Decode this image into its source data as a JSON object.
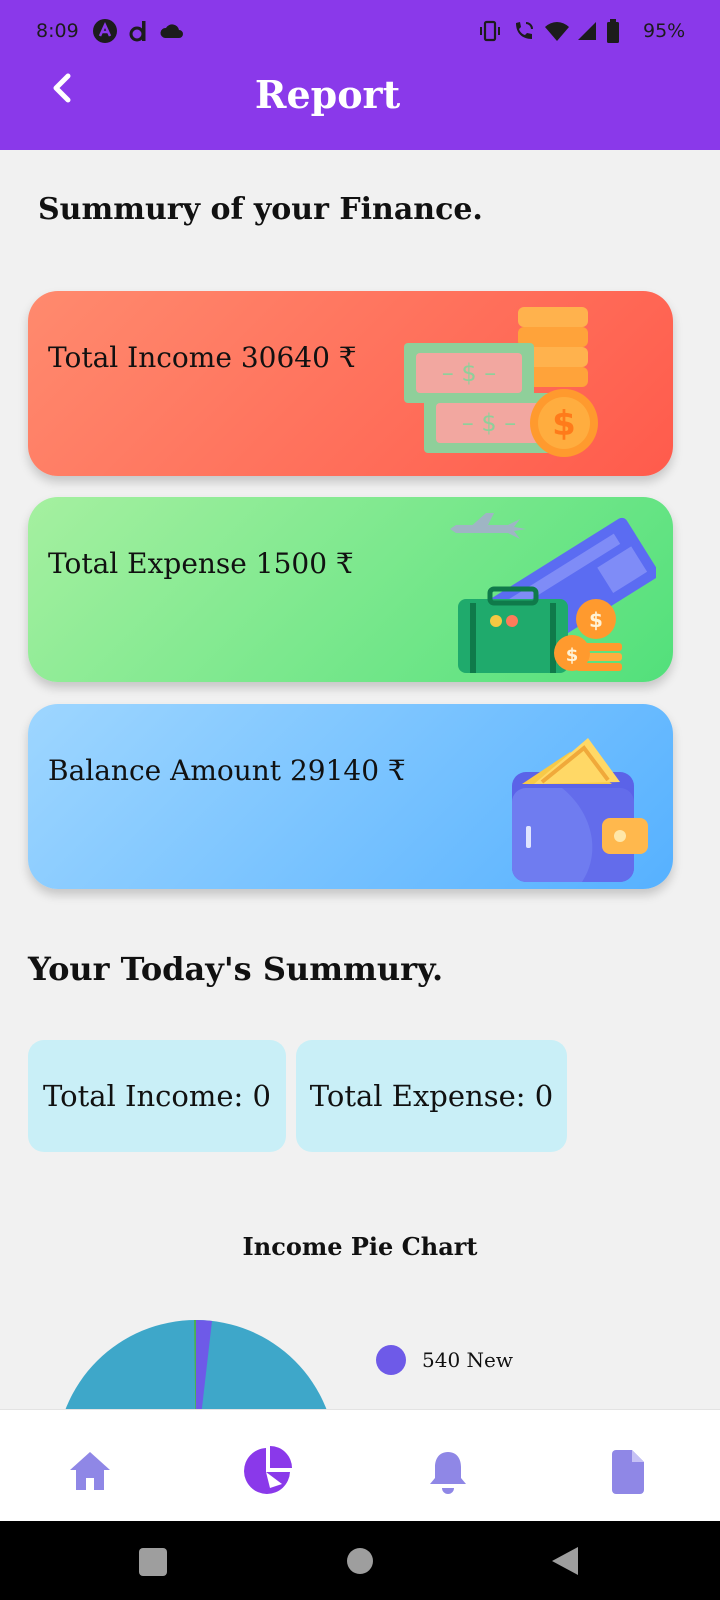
{
  "status_bar": {
    "time": "8:09",
    "battery": "95%",
    "icons": [
      "app-a-icon",
      "app-d-icon",
      "cloud-icon",
      "vibrate-icon",
      "wifi-call-icon",
      "wifi-icon",
      "signal-icon",
      "battery-icon"
    ]
  },
  "header": {
    "title": "Report",
    "back_icon": "chevron-left-icon",
    "color": "#8a39ea"
  },
  "finance": {
    "heading": "Summury of your Finance.",
    "cards": [
      {
        "label": "Total Income 30640 ₹",
        "icon": "money-coins-icon",
        "color": "#ff6a55"
      },
      {
        "label": "Total Expense 1500 ₹",
        "icon": "travel-expense-icon",
        "color": "#6be383"
      },
      {
        "label": "Balance Amount 29140 ₹",
        "icon": "wallet-icon",
        "color": "#78c2ff"
      }
    ]
  },
  "today": {
    "heading": "Your Today's Summury.",
    "income": "Total Income: 0",
    "expense": "Total Expense: 0"
  },
  "chart_data": {
    "type": "pie",
    "title": "Income Pie Chart",
    "legend": [
      {
        "label": "540 New",
        "color": "#6e5ae8"
      }
    ],
    "visible_slice_colors": [
      "#3ea7c9",
      "#6e5ae8",
      "#4caf50"
    ]
  },
  "bottom_nav": {
    "items": [
      {
        "name": "home",
        "icon": "home-icon",
        "active": false
      },
      {
        "name": "report",
        "icon": "pie-chart-icon",
        "active": true
      },
      {
        "name": "notifications",
        "icon": "bell-icon",
        "active": false
      },
      {
        "name": "documents",
        "icon": "document-icon",
        "active": false
      }
    ],
    "active_color": "#8a39ea",
    "inactive_color": "#8f87e6"
  },
  "system_nav": {
    "items": [
      "recents-icon",
      "home-circle-icon",
      "back-triangle-icon"
    ]
  }
}
